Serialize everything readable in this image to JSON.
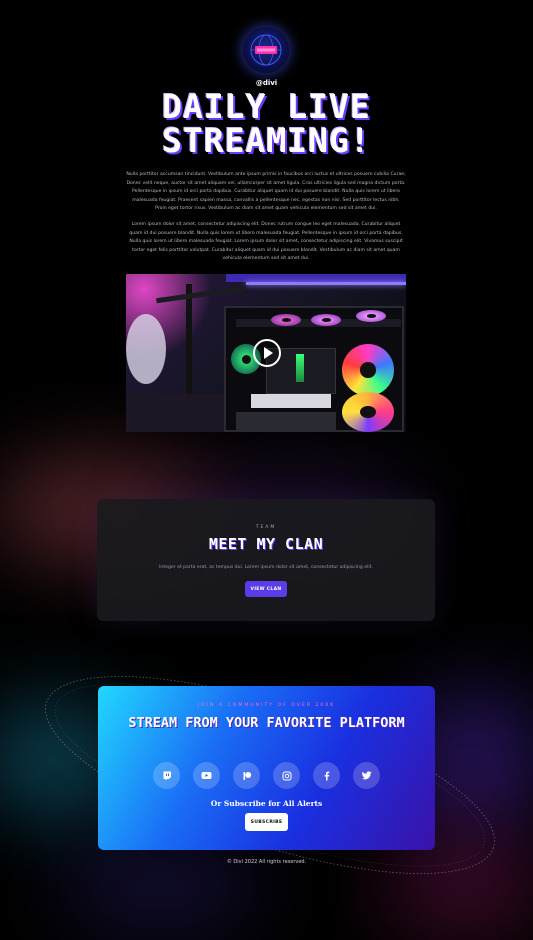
{
  "header": {
    "handle": "@divi",
    "title_line1": "DAILY LIVE",
    "title_line2": "STREAMING!",
    "logo_icon": "globe-badge-icon"
  },
  "intro": {
    "paragraph1": "Nulla porttitor accumsan tincidunt. Vestibulum ante ipsum primis in faucibus orci luctus et ultrices posuere cubilia Curae; Donec velit neque, auctor sit amet aliquam vel, ullamcorper sit amet ligula. Cras ultricies ligula sed magna dictum porta. Pellentesque in ipsum id orci porta dapibus. Curabitur aliquet quam id dui posuere blandit. Nulla quis lorem ut libero malesuada feugiat. Praesent sapien massa, convallis a pellentesque nec, egestas non nisi. Sed porttitor lectus nibh. Proin eget tortor risus. Vestibulum ac diam sit amet quam vehicula elementum sed sit amet dui.",
    "paragraph2": "Lorem ipsum dolor sit amet, consectetur adipiscing elit. Donec rutrum congue leo eget malesuada. Curabitur aliquet quam id dui posuere blandit. Nulla quis lorem ut libero malesuada feugiat. Pellentesque in ipsum id orci porta dapibus. Nulla quis lorem ut libero malesuada feugiat. Lorem ipsum dolor sit amet, consectetur adipiscing elit. Vivamus suscipit tortor eget felis porttitor volutpat. Curabitur aliquet quam id dui posuere blandit. Vestibulum ac diam sit amet quam vehicula elementum sed sit amet dui."
  },
  "video": {
    "play_icon": "play-icon"
  },
  "clan": {
    "eyebrow": "TEAM",
    "title": "MEET MY CLAN",
    "description": "Integer et porta erat, ac tempus dui. Lorem ipsum dolor sit amet, consectetur adipiscing elit.",
    "button_label": "VIEW CLAN",
    "button_color": "#5b3ce8"
  },
  "cta": {
    "eyebrow": "JOIN A COMMUNITY OF OVER 200K",
    "title": "STREAM FROM YOUR FAVORITE PLATFORM",
    "subscribe_text": "Or Subscribe for All Alerts",
    "button_label": "SUBSCRIBE",
    "socials": [
      "twitch-icon",
      "youtube-icon",
      "patreon-icon",
      "instagram-icon",
      "facebook-icon",
      "twitter-icon"
    ],
    "eyebrow_color": "#ff6ad5"
  },
  "footer": {
    "text": "© Divi 2022 All rights reserved."
  }
}
